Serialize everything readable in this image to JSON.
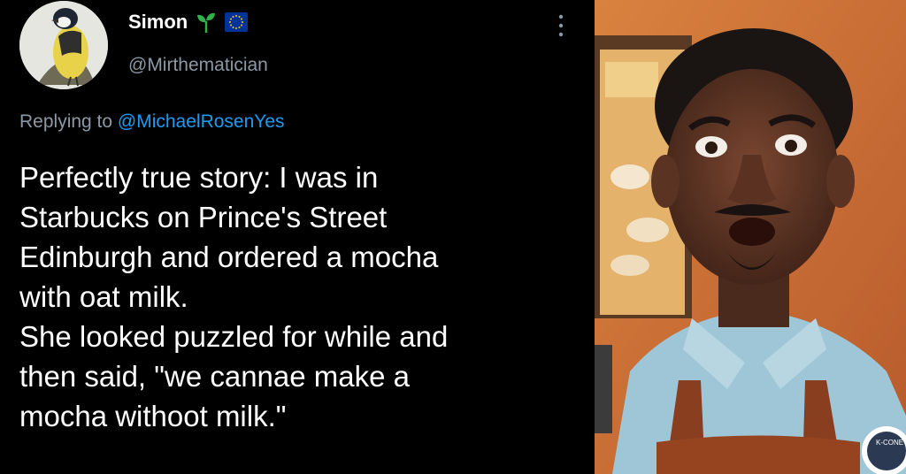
{
  "tweet": {
    "display_name": "Simon",
    "handle": "@Mirthematician",
    "reply_prefix": "Replying to",
    "reply_mention": "@MichaelRosenYes",
    "lines": [
      "Perfectly true story: I was in",
      "Starbucks on Prince's Street",
      "Edinburgh and ordered a mocha",
      "with oat milk.",
      "She looked puzzled for while and",
      "then said, \"we cannae make a",
      "mocha withoot milk.\""
    ],
    "icons": {
      "avatar": "bird-avatar",
      "badge_1": "sprout-icon",
      "badge_2": "eu-flag-icon",
      "menu": "more-options-icon"
    }
  },
  "reaction_photo": {
    "apron_badge": "K-CONE"
  },
  "colors": {
    "background": "#000000",
    "text": "#ffffff",
    "secondary": "#8b98a5",
    "mention": "#1d9bf0",
    "sprout": "#2fb34a",
    "eu_blue": "#003399",
    "eu_star": "#ffcc00"
  }
}
